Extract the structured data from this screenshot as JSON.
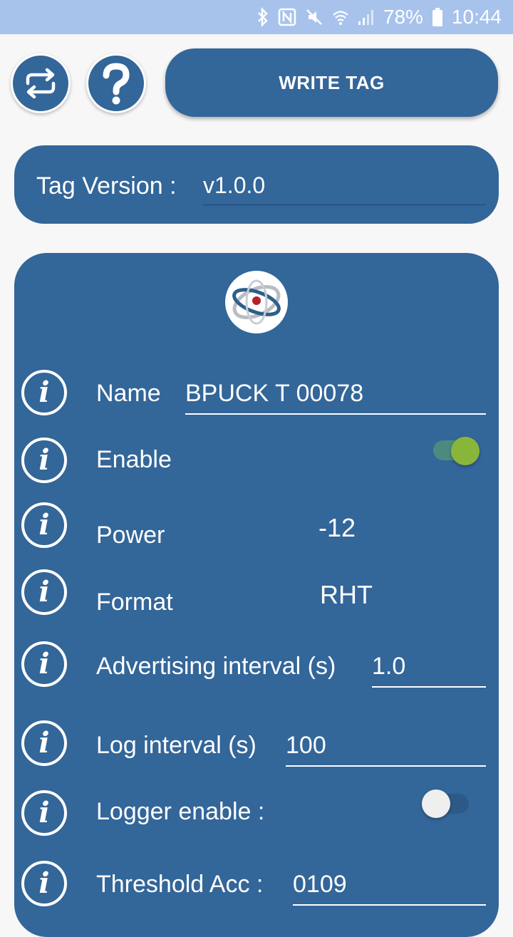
{
  "status_bar": {
    "battery": "78%",
    "time": "10:44",
    "icons": [
      "bluetooth-icon",
      "nfc-icon",
      "mute-icon",
      "wifi-icon",
      "signal-icon",
      "battery-icon"
    ]
  },
  "toolbar": {
    "swap_icon": "swap-arrows-icon",
    "help_icon": "question-icon",
    "write_label": "WRITE TAG"
  },
  "tag_version": {
    "label": "Tag Version :",
    "value": "v1.0.0"
  },
  "settings": {
    "name": {
      "label": "Name",
      "value": "BPUCK T 00078"
    },
    "enable": {
      "label": "Enable",
      "on": true
    },
    "power": {
      "label": "Power",
      "value": "-12"
    },
    "format": {
      "label": "Format",
      "value": "RHT"
    },
    "adv_interval": {
      "label": "Advertising interval (s)",
      "value": "1.0"
    },
    "log_interval": {
      "label": "Log interval (s)",
      "value": "100"
    },
    "logger_enable": {
      "label": "Logger enable :",
      "on": false
    },
    "threshold_acc": {
      "label": "Threshold Acc :",
      "value": "0109"
    },
    "info_glyph": "i"
  },
  "colors": {
    "primary": "#336699",
    "status_bar": "#a7c3ec",
    "switch_on": "#8ab53b",
    "background": "#f7f7f8"
  }
}
